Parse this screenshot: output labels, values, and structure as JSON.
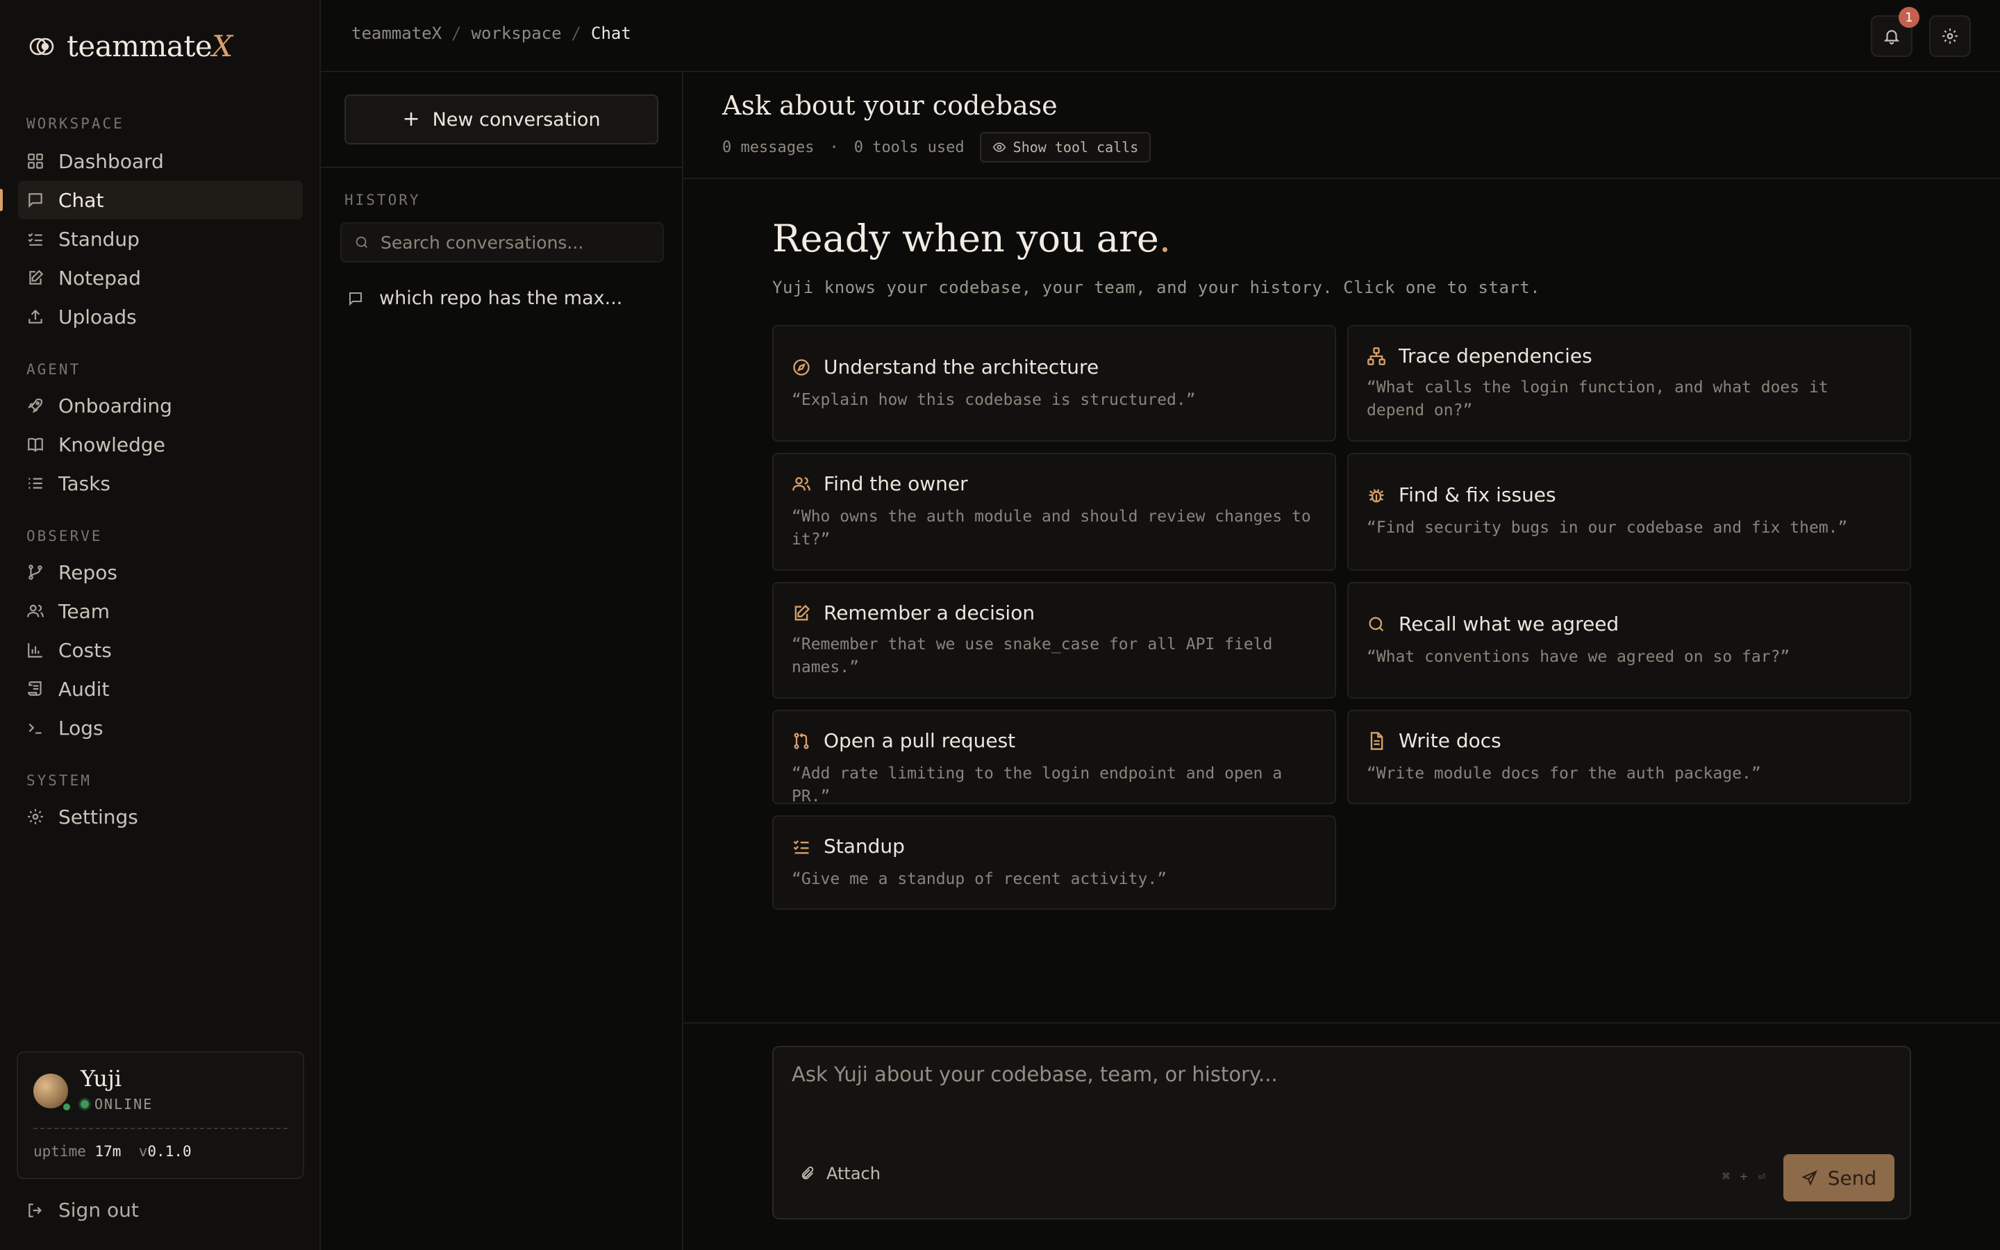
{
  "app": {
    "name": "teammate",
    "name_suffix": "X"
  },
  "sidebar": {
    "sections": {
      "workspace": "WORKSPACE",
      "agent": "AGENT",
      "observe": "OBSERVE",
      "system": "SYSTEM"
    },
    "items": [
      {
        "label": "Dashboard",
        "icon": "grid-icon"
      },
      {
        "label": "Chat",
        "icon": "message-icon",
        "active": true
      },
      {
        "label": "Standup",
        "icon": "checklist-icon"
      },
      {
        "label": "Notepad",
        "icon": "edit-icon"
      },
      {
        "label": "Uploads",
        "icon": "upload-icon"
      },
      {
        "label": "Onboarding",
        "icon": "rocket-icon"
      },
      {
        "label": "Knowledge",
        "icon": "book-icon"
      },
      {
        "label": "Tasks",
        "icon": "list-icon"
      },
      {
        "label": "Repos",
        "icon": "git-branch-icon"
      },
      {
        "label": "Team",
        "icon": "users-icon"
      },
      {
        "label": "Costs",
        "icon": "bar-chart-icon"
      },
      {
        "label": "Audit",
        "icon": "scroll-icon"
      },
      {
        "label": "Logs",
        "icon": "terminal-icon"
      },
      {
        "label": "Settings",
        "icon": "gear-icon"
      }
    ],
    "user": {
      "name": "Yuji",
      "status": "ONLINE",
      "uptime_label": "uptime",
      "uptime": "17m",
      "version_prefix": "v",
      "version": "0.1.0"
    },
    "signout": "Sign out"
  },
  "topbar": {
    "breadcrumb": [
      "teammateX",
      "workspace",
      "Chat"
    ],
    "breadcrumb_sep": "/",
    "notification_count": "1"
  },
  "conversations": {
    "new_label": "New conversation",
    "history_label": "HISTORY",
    "search_placeholder": "Search conversations...",
    "items": [
      "which repo has the max..."
    ]
  },
  "main": {
    "title": "Ask about your codebase",
    "messages": "0 messages",
    "meta_sep": "·",
    "tools": "0 tools used",
    "show_tools": "Show tool calls",
    "hero_title": "Ready when you are",
    "hero_dot": ".",
    "hero_sub": "Yuji knows your codebase, your team, and your history. Click one to start.",
    "cards": [
      {
        "title": "Understand the architecture",
        "desc": "“Explain how this codebase is structured.”",
        "icon": "compass-icon"
      },
      {
        "title": "Trace dependencies",
        "desc": "“What calls the login function, and what does it depend on?”",
        "icon": "sitemap-icon"
      },
      {
        "title": "Find the owner",
        "desc": "“Who owns the auth module and should review changes to it?”",
        "icon": "users-icon"
      },
      {
        "title": "Find & fix issues",
        "desc": "“Find security bugs in our codebase and fix them.”",
        "icon": "bug-icon"
      },
      {
        "title": "Remember a decision",
        "desc": "“Remember that we use snake_case for all API field names.”",
        "icon": "edit-icon"
      },
      {
        "title": "Recall what we agreed",
        "desc": "“What conventions have we agreed on so far?”",
        "icon": "search-icon"
      },
      {
        "title": "Open a pull request",
        "desc": "“Add rate limiting to the login endpoint and open a PR.”",
        "icon": "pull-request-icon"
      },
      {
        "title": "Write docs",
        "desc": "“Write module docs for the auth package.”",
        "icon": "file-text-icon"
      },
      {
        "title": "Standup",
        "desc": "“Give me a standup of recent activity.”",
        "icon": "checklist-icon"
      }
    ]
  },
  "composer": {
    "placeholder": "Ask Yuji about your codebase, team, or history...",
    "attach": "Attach",
    "shortcut": "⌘ + ⏎",
    "send": "Send"
  },
  "colors": {
    "accent": "#d9a06a",
    "background": "#0b0b0a",
    "send_button": "#8d6a49",
    "badge": "#c2614f",
    "online": "#3b9a57"
  }
}
